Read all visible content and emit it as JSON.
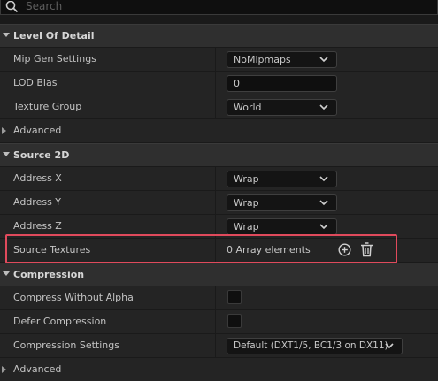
{
  "search": {
    "placeholder": "Search",
    "icon": "search-icon"
  },
  "sections": {
    "lod": {
      "title": "Level Of Detail"
    },
    "source2d": {
      "title": "Source 2D"
    },
    "compression": {
      "title": "Compression"
    }
  },
  "lod": {
    "mip_gen": {
      "label": "Mip Gen Settings",
      "value": "NoMipmaps"
    },
    "lod_bias": {
      "label": "LOD Bias",
      "value": "0"
    },
    "texture_group": {
      "label": "Texture Group",
      "value": "World"
    },
    "advanced": {
      "label": "Advanced"
    }
  },
  "source2d": {
    "address_x": {
      "label": "Address X",
      "value": "Wrap"
    },
    "address_y": {
      "label": "Address Y",
      "value": "Wrap"
    },
    "address_z": {
      "label": "Address Z",
      "value": "Wrap"
    },
    "source_textures": {
      "label": "Source Textures",
      "value": "0 Array elements"
    }
  },
  "compression": {
    "without_alpha": {
      "label": "Compress Without Alpha",
      "checked": false
    },
    "defer": {
      "label": "Defer Compression",
      "checked": false
    },
    "settings": {
      "label": "Compression Settings",
      "value": "Default (DXT1/5, BC1/3 on DX11)"
    },
    "advanced": {
      "label": "Advanced"
    }
  },
  "colors": {
    "highlight": "#e04a5c",
    "panel": "#242424",
    "header": "#2f2f2f"
  }
}
